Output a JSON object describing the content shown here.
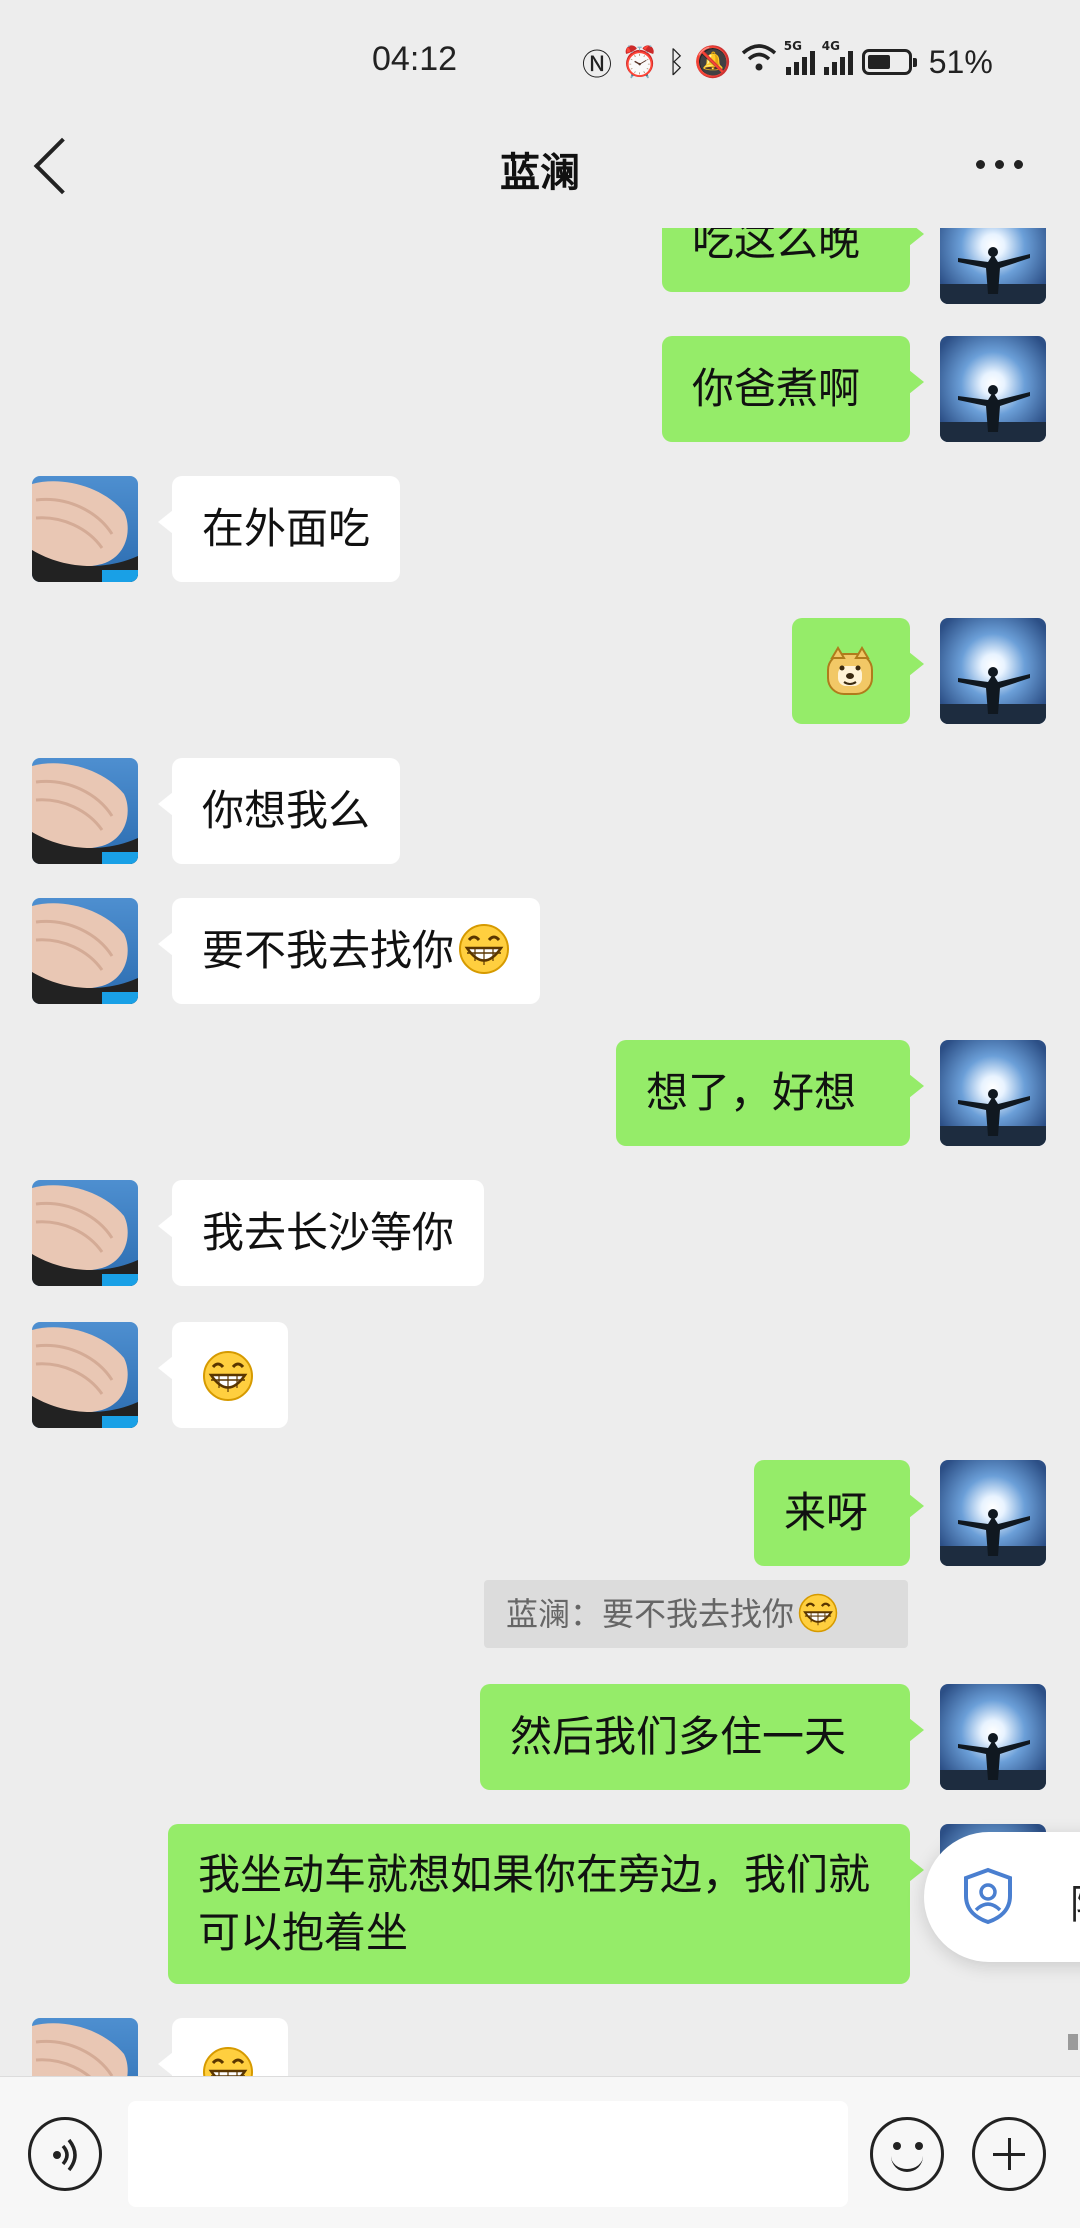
{
  "status_bar": {
    "time": "04:12",
    "network_5g": "5G",
    "network_4g": "4G",
    "battery_pct": "51%"
  },
  "header": {
    "title": "蓝澜",
    "back_icon": "chevron-left-icon",
    "more_icon": "more-dots-icon"
  },
  "messages": [
    {
      "side": "out",
      "text": "吃这么晚"
    },
    {
      "side": "out",
      "text": "你爸煮啊"
    },
    {
      "side": "in",
      "text": "在外面吃"
    },
    {
      "side": "out",
      "sticker": "doge-emoji"
    },
    {
      "side": "in",
      "text": "你想我么"
    },
    {
      "side": "in",
      "text": "要不我去找你",
      "emoji": "grin-emoji"
    },
    {
      "side": "out",
      "text": "想了，好想"
    },
    {
      "side": "in",
      "text": "我去长沙等你"
    },
    {
      "side": "in",
      "emoji": "grin-emoji"
    },
    {
      "side": "out",
      "text": "来呀"
    },
    {
      "side": "out",
      "text": "然后我们多住一天"
    },
    {
      "side": "out",
      "text": "我坐动车就想如果你在旁边，我们就可以抱着坐"
    },
    {
      "side": "in",
      "emoji": "grin-emoji"
    }
  ],
  "quote": {
    "text": "蓝澜：要不我去找你",
    "emoji": "grin-emoji"
  },
  "floating_button": {
    "label": "隐",
    "icon": "shield-user-icon"
  },
  "input_bar": {
    "voice_icon": "voice-icon",
    "input_value": "",
    "emoji_icon": "smile-icon",
    "plus_icon": "plus-icon"
  },
  "colors": {
    "background": "#ededed",
    "outgoing_bubble": "#95ec69",
    "incoming_bubble": "#ffffff"
  }
}
